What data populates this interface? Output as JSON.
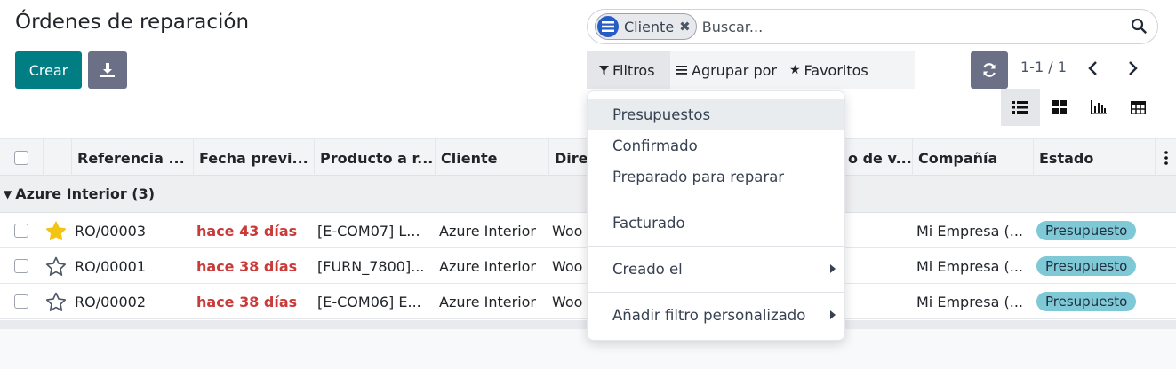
{
  "page": {
    "title": "Órdenes de reparación"
  },
  "toolbar": {
    "create_label": "Crear",
    "download_icon": "download-icon"
  },
  "search": {
    "facet_label": "Cliente",
    "facet_remove": "✖",
    "placeholder": "Buscar..."
  },
  "filter_bar": {
    "filters_label": "Filtros",
    "group_label": "Agrupar por",
    "favorites_label": "Favoritos"
  },
  "pager": {
    "text": "1-1 / 1"
  },
  "table": {
    "headers": [
      "Referencia ...",
      "Fecha previ...",
      "Producto a r...",
      "Cliente",
      "Direc",
      "o de v...",
      "Compañía",
      "Estado"
    ],
    "group": {
      "label": "Azure Interior (3)"
    },
    "rows": [
      {
        "starred": true,
        "ref": "RO/00003",
        "date": "hace 43 días",
        "product": "[E-COM07] L...",
        "customer": "Azure Interior",
        "address": "Woo",
        "company": "Mi Empresa (...",
        "status": "Presupuesto"
      },
      {
        "starred": false,
        "ref": "RO/00001",
        "date": "hace 38 días",
        "product": "[FURN_7800]...",
        "customer": "Azure Interior",
        "address": "Woo",
        "company": "Mi Empresa (...",
        "status": "Presupuesto"
      },
      {
        "starred": false,
        "ref": "RO/00002",
        "date": "hace 38 días",
        "product": "[E-COM06] E...",
        "customer": "Azure Interior",
        "address": "Woo",
        "company": "Mi Empresa (...",
        "status": "Presupuesto"
      }
    ]
  },
  "dropdown": {
    "items": [
      "Presupuestos",
      "Confirmado",
      "Preparado para reparar",
      "Facturado",
      "Creado el",
      "Añadir filtro personalizado"
    ]
  },
  "colors": {
    "primary": "#017e84",
    "secondary": "#6c7087",
    "late": "#c93a38",
    "badge": "#7fc8d6",
    "star": "#f3c413"
  }
}
